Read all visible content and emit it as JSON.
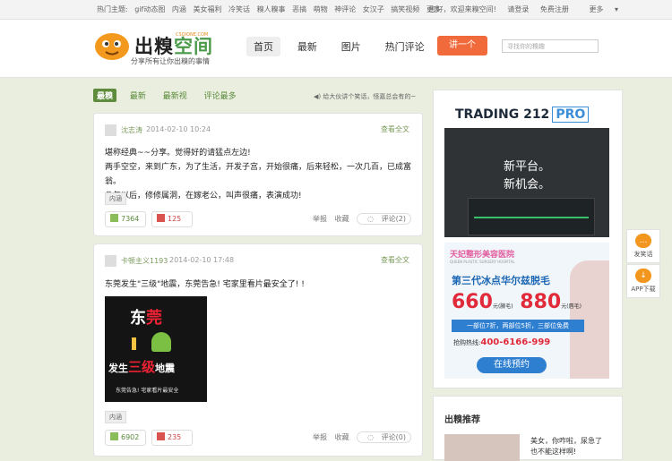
{
  "topbar": {
    "label": "热门主题:",
    "links": [
      "gif动态图",
      "内涵",
      "美女福利",
      "冷笑话",
      "糗人糗事",
      "恶搞",
      "萌物",
      "神评论",
      "女汉子",
      "搞笑视频",
      "更多"
    ],
    "welcome": "您好，欢迎来糗空间!",
    "login": "请登录",
    "register": "免费注册",
    "more": "更多"
  },
  "header": {
    "logo_text_a": "出糗",
    "logo_text_b": "空间",
    "logo_domain": "CSQIONE.COM",
    "slogan": "分享所有让你出糗的事情",
    "nav": [
      "首页",
      "最新",
      "图片",
      "热门评论"
    ],
    "post_button": "讲一个",
    "search_placeholder": "寻找你的糗趣"
  },
  "filters": {
    "tabs": [
      "最糗",
      "最新",
      "最新视",
      "评论最多"
    ],
    "notice": "给大伙讲个笑话，怪嘉总会有的~"
  },
  "posts": [
    {
      "author": "沈志涛",
      "time": "2014-02-10 10:24",
      "view_all": "查看全文",
      "lines": [
        "堪称经典~~分享。觉得好的请猛点左边!",
        "两手空空，来到广东，为了生活，开发子宫，开始很痛，后来轻松，一次几百，已成富翁。",
        "几年以后，修修属洞，在嫁老公，叫声很痛，表演成功!"
      ],
      "tag": "内涵",
      "likes": "7364",
      "dislikes": "125",
      "report": "举报",
      "collect": "收藏",
      "comments": "评论(2)"
    },
    {
      "author": "卡顿主义1193",
      "time": "2014-02-10 17:48",
      "view_all": "查看全文",
      "lines": [
        "东莞发生\"三级\"地震，东莞告急! 宅家里看片最安全了! !"
      ],
      "meme": {
        "title_a": "东",
        "title_b": "莞",
        "line_a": "发生",
        "line_b": "三级",
        "line_c": "地震",
        "caption": "东莞告急! 宅家看片最安全"
      },
      "tag": "内涵",
      "likes": "6902",
      "dislikes": "235",
      "report": "举报",
      "collect": "收藏",
      "comments": "评论(0)"
    }
  ],
  "ads": {
    "ad1": {
      "brand": "TRADING 212",
      "pro": "PRO",
      "line1": "新平台。",
      "line2": "新机会。"
    },
    "ad2": {
      "hospital": "天妃整形美容医院",
      "hospital_en": "QUEEN PLASTIC SURGERY HOSPITAL",
      "headline": "第三代冰点华尔兹脱毛",
      "price1": "660",
      "unit1": "元(腋毛)",
      "price2": "880",
      "unit2": "元(唇毛)",
      "offer": "一部位7折，两部位5折，三部位免费",
      "tel_label": "抢购热线:",
      "tel": "400-6166-999",
      "button": "在线预约"
    }
  },
  "recommend": {
    "title": "出糗推荐",
    "item_text": "美女，你咋啦，尿急了也不能这样啊!"
  },
  "float_buttons": [
    "发笑话",
    "APP下载"
  ]
}
